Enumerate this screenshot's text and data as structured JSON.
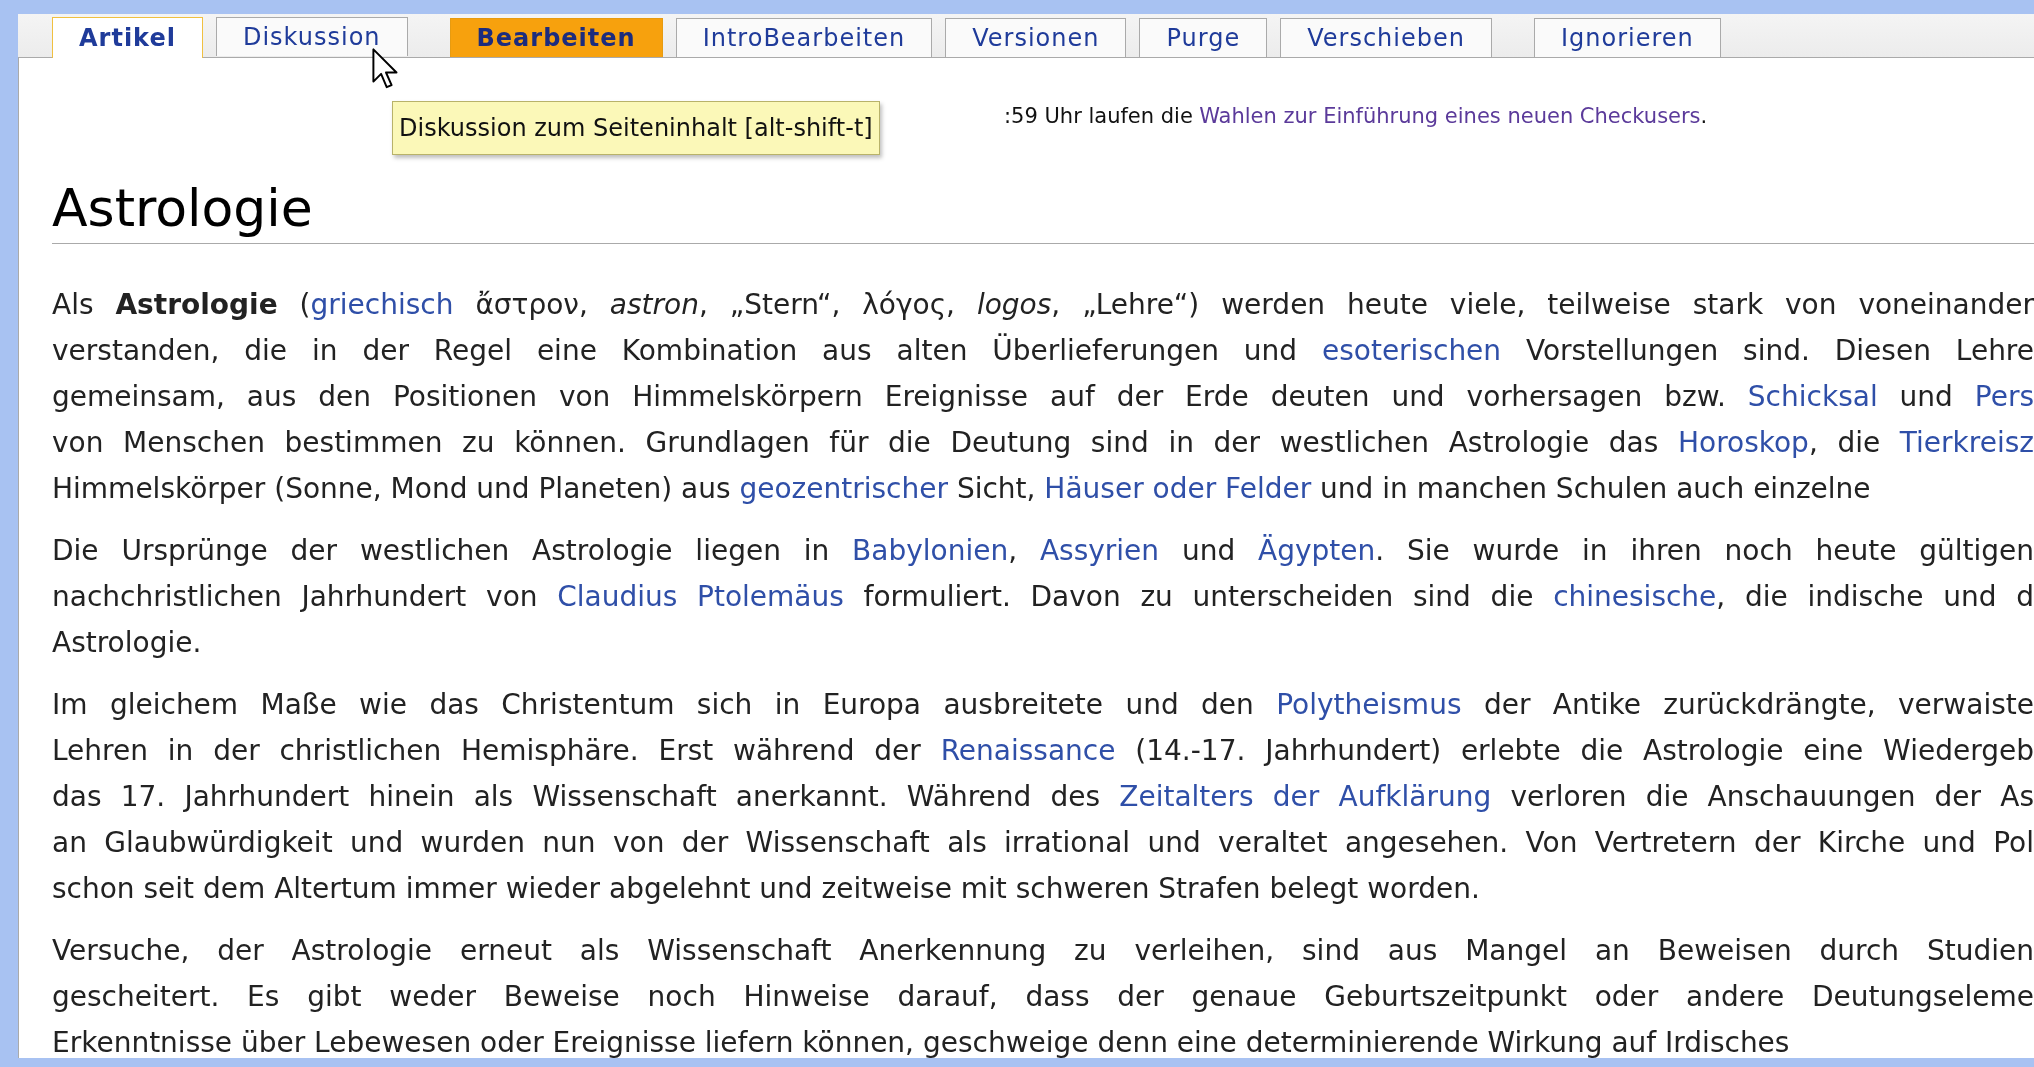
{
  "tab_groups": [
    [
      {
        "label": "Artikel",
        "selected": true,
        "emphasized": false
      },
      {
        "label": "Diskussion",
        "selected": false,
        "emphasized": false
      }
    ],
    [
      {
        "label": "Bearbeiten",
        "selected": false,
        "emphasized": true
      },
      {
        "label": "IntroBearbeiten",
        "selected": false,
        "emphasized": false
      },
      {
        "label": "Versionen",
        "selected": false,
        "emphasized": false
      },
      {
        "label": "Purge",
        "selected": false,
        "emphasized": false
      },
      {
        "label": "Verschieben",
        "selected": false,
        "emphasized": false
      }
    ],
    [
      {
        "label": "Ignorieren",
        "selected": false,
        "emphasized": false
      }
    ]
  ],
  "tooltip": {
    "text": "Diskussion zum Seiteninhalt [alt-shift-t]"
  },
  "notice": [
    {
      "kind": "text",
      "text": ":59 Uhr laufen die"
    },
    {
      "kind": "visited_link",
      "text": "Wahlen zur Einführung eines neuen Checkusers"
    },
    {
      "kind": "text",
      "text": "."
    }
  ],
  "title": "Astrologie",
  "paragraphs": [
    {
      "lines": [
        [
          {
            "kind": "text",
            "text": "Als **Astrologie** ("
          },
          {
            "kind": "link",
            "text": "griechisch"
          },
          {
            "kind": "text",
            "text": " ἄστρον, *astron*, „Stern“, λόγος, *logos*, „Lehre“) werden heute viele, teilweise stark von voneinander"
          }
        ],
        [
          {
            "kind": "text",
            "text": "verstanden, die in der Regel eine Kombination aus alten Überlieferungen und "
          },
          {
            "kind": "link",
            "text": "esoterischen"
          },
          {
            "kind": "text",
            "text": " Vorstellungen sind. Diesen Lehre"
          }
        ],
        [
          {
            "kind": "text",
            "text": "gemeinsam, aus den Positionen von Himmelskörpern Ereignisse auf der Erde deuten und vorhersagen bzw. "
          },
          {
            "kind": "link",
            "text": "Schicksal"
          },
          {
            "kind": "text",
            "text": " und "
          },
          {
            "kind": "link",
            "text": "Pers"
          }
        ],
        [
          {
            "kind": "text",
            "text": "von Menschen bestimmen zu können. Grundlagen für die Deutung sind in der westlichen Astrologie das "
          },
          {
            "kind": "link",
            "text": "Horoskop"
          },
          {
            "kind": "text",
            "text": ", die "
          },
          {
            "kind": "link",
            "text": "Tierkreisz"
          }
        ],
        [
          {
            "kind": "text",
            "text": "Himmelskörper (Sonne, Mond und Planeten) aus "
          },
          {
            "kind": "link",
            "text": "geozentrischer"
          },
          {
            "kind": "text",
            "text": " Sicht, "
          },
          {
            "kind": "link",
            "text": "Häuser oder Felder"
          },
          {
            "kind": "text",
            "text": " und in manchen Schulen auch einzelne"
          }
        ]
      ]
    },
    {
      "lines": [
        [
          {
            "kind": "text",
            "text": "Die Ursprünge der westlichen Astrologie liegen in "
          },
          {
            "kind": "link",
            "text": "Babylonien"
          },
          {
            "kind": "text",
            "text": ", "
          },
          {
            "kind": "link",
            "text": "Assyrien"
          },
          {
            "kind": "text",
            "text": " und "
          },
          {
            "kind": "link",
            "text": "Ägypten"
          },
          {
            "kind": "text",
            "text": ". Sie wurde in ihren noch heute gültigen"
          }
        ],
        [
          {
            "kind": "text",
            "text": "nachchristlichen Jahrhundert von "
          },
          {
            "kind": "link",
            "text": "Claudius Ptolemäus"
          },
          {
            "kind": "text",
            "text": " formuliert. Davon zu unterscheiden sind die "
          },
          {
            "kind": "link",
            "text": "chinesische"
          },
          {
            "kind": "text",
            "text": ", die indische und d"
          }
        ],
        [
          {
            "kind": "text",
            "text": "Astrologie."
          }
        ]
      ]
    },
    {
      "lines": [
        [
          {
            "kind": "text",
            "text": "Im gleichem Maße wie das Christentum sich in Europa ausbreitete und den "
          },
          {
            "kind": "link",
            "text": "Polytheismus"
          },
          {
            "kind": "text",
            "text": " der Antike zurückdrängte, verwaiste"
          }
        ],
        [
          {
            "kind": "text",
            "text": "Lehren in der christlichen Hemisphäre. Erst während der "
          },
          {
            "kind": "link",
            "text": "Renaissance"
          },
          {
            "kind": "text",
            "text": " (14.-17. Jahrhundert) erlebte die Astrologie eine Wiedergeb"
          }
        ],
        [
          {
            "kind": "text",
            "text": "das 17. Jahrhundert hinein als Wissenschaft anerkannt. Während des "
          },
          {
            "kind": "link",
            "text": "Zeitalters der Aufklärung"
          },
          {
            "kind": "text",
            "text": " verloren die Anschauungen der As"
          }
        ],
        [
          {
            "kind": "text",
            "text": "an Glaubwürdigkeit und wurden nun von der Wissenschaft als irrational und veraltet angesehen. Von Vertretern der Kirche und Pol"
          }
        ],
        [
          {
            "kind": "text",
            "text": "schon seit dem Altertum immer wieder abgelehnt und zeitweise mit schweren Strafen belegt worden."
          }
        ]
      ]
    },
    {
      "lines": [
        [
          {
            "kind": "text",
            "text": "Versuche, der Astrologie erneut als Wissenschaft Anerkennung zu verleihen, sind aus Mangel an Beweisen durch Studien"
          }
        ],
        [
          {
            "kind": "text",
            "text": "gescheitert. Es gibt weder Beweise noch Hinweise darauf, dass der genaue Geburtszeitpunkt oder andere Deutungseleme"
          }
        ],
        [
          {
            "kind": "text",
            "text": "Erkenntnisse über Lebewesen oder Ereignisse liefern können, geschweige denn eine determinierende Wirkung auf Irdisches"
          }
        ]
      ]
    }
  ]
}
